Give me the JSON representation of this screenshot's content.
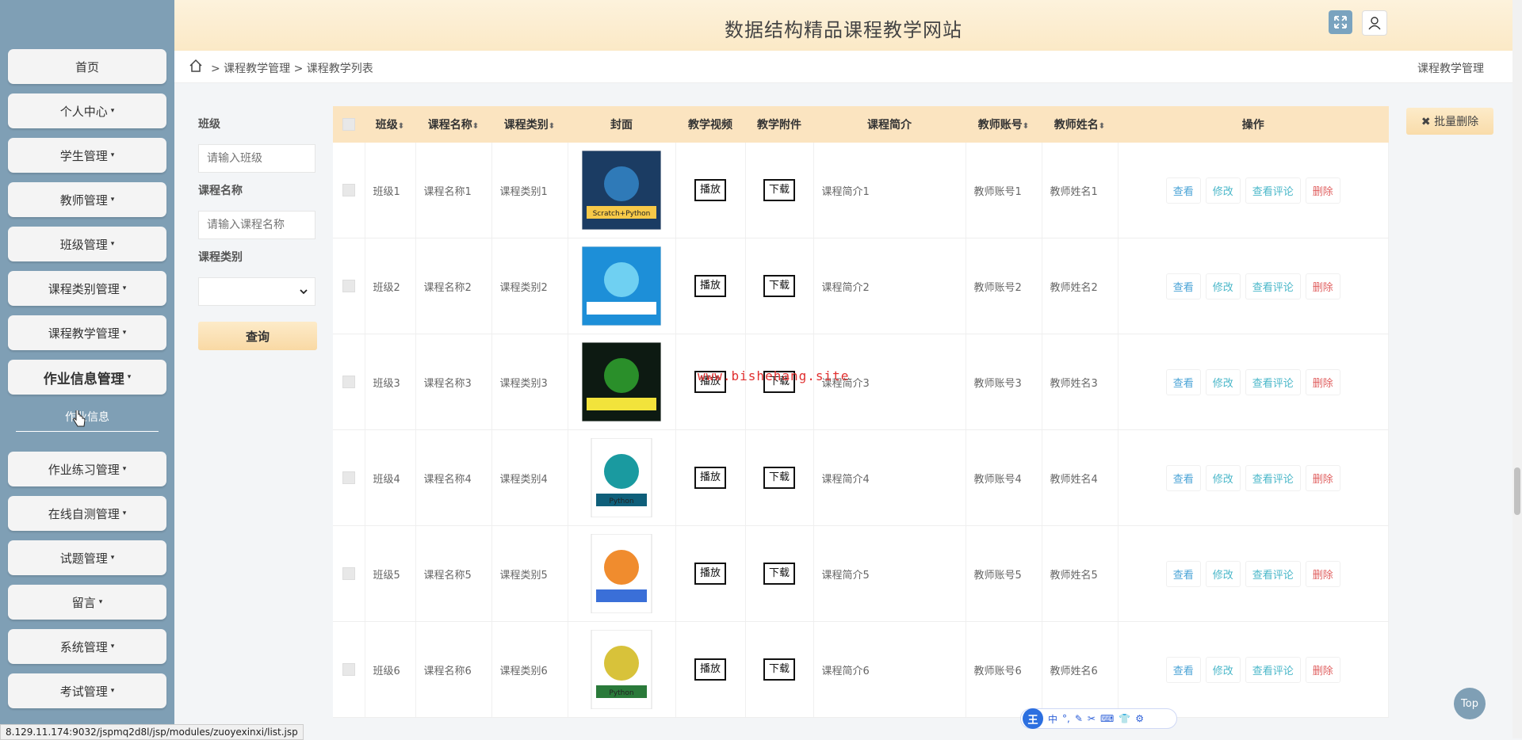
{
  "site_title": "数据结构精品课程教学网站",
  "sidebar": {
    "items": [
      {
        "label": "首页"
      },
      {
        "label": "个人中心"
      },
      {
        "label": "学生管理"
      },
      {
        "label": "教师管理"
      },
      {
        "label": "班级管理"
      },
      {
        "label": "课程类别管理"
      },
      {
        "label": "课程教学管理"
      },
      {
        "label": "作业信息管理"
      },
      {
        "label": "作业练习管理"
      },
      {
        "label": "在线自测管理"
      },
      {
        "label": "试题管理"
      },
      {
        "label": "留言"
      },
      {
        "label": "系统管理"
      },
      {
        "label": "考试管理"
      }
    ],
    "submenu_label": "作业信息",
    "caret": "▾"
  },
  "breadcrumb": {
    "path": "> 课程教学管理 > 课程教学列表",
    "right": "课程教学管理"
  },
  "filters": {
    "class_label": "班级",
    "class_placeholder": "请输入班级",
    "course_label": "课程名称",
    "course_placeholder": "请输入课程名称",
    "category_label": "课程类别",
    "query_label": "查询"
  },
  "batch_delete_label": "✖ 批量删除",
  "table": {
    "headers": [
      "班级",
      "课程名称",
      "课程类别",
      "封面",
      "教学视频",
      "教学附件",
      "课程简介",
      "教师账号",
      "教师姓名",
      "操作"
    ],
    "sort_icon": "⬍",
    "rows": [
      {
        "cls": "班级1",
        "name": "课程名称1",
        "cat": "课程类别1",
        "intro": "课程简介1",
        "acct": "教师账号1",
        "tname": "教师姓名1"
      },
      {
        "cls": "班级2",
        "name": "课程名称2",
        "cat": "课程类别2",
        "intro": "课程简介2",
        "acct": "教师账号2",
        "tname": "教师姓名2"
      },
      {
        "cls": "班级3",
        "name": "课程名称3",
        "cat": "课程类别3",
        "intro": "课程简介3",
        "acct": "教师账号3",
        "tname": "教师姓名3"
      },
      {
        "cls": "班级4",
        "name": "课程名称4",
        "cat": "课程类别4",
        "intro": "课程简介4",
        "acct": "教师账号4",
        "tname": "教师姓名4"
      },
      {
        "cls": "班级5",
        "name": "课程名称5",
        "cat": "课程类别5",
        "intro": "课程简介5",
        "acct": "教师账号5",
        "tname": "教师姓名5"
      },
      {
        "cls": "班级6",
        "name": "课程名称6",
        "cat": "课程类别6",
        "intro": "课程简介6",
        "acct": "教师账号6",
        "tname": "教师姓名6"
      }
    ],
    "play_label": "播放",
    "download_label": "下载",
    "op_view": "查看",
    "op_edit": "修改",
    "op_comment": "查看评论",
    "op_delete": "删除",
    "cover_texts": [
      "Scratch+Python",
      "",
      "",
      "Python",
      "",
      "Python"
    ]
  },
  "watermark": "www.bishehang.site",
  "top_label": "Top",
  "ime": {
    "logo": "王",
    "lang": "中"
  },
  "status_url": "8.129.11.174:9032/jspmq2d8l/jsp/modules/zuoyexinxi/list.jsp",
  "colors": {
    "sidebar": "#7f9fb5",
    "header": "#fbe9c6",
    "accent": "#4aa3d6",
    "danger": "#e06060"
  }
}
